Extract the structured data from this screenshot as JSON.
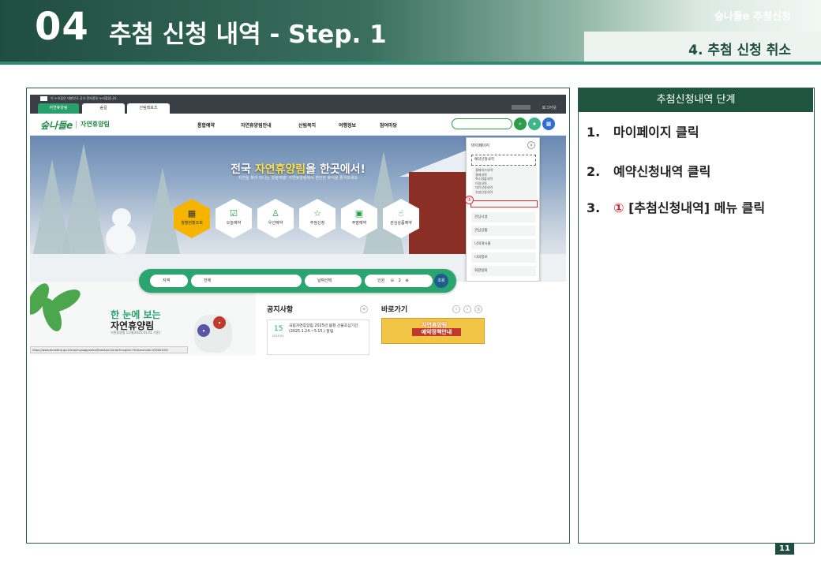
{
  "header": {
    "number": "04",
    "title": "추첨 신청 내역 - Step. 1",
    "top_right": "숲나들e 추첨신청",
    "subtitle": "4. 추첨 신청 취소"
  },
  "screenshot": {
    "gov_notice": "이 누리집은 대한민국 공식 전자정부 누리집입니다.",
    "site_tabs": [
      "자연휴양림",
      "숲길",
      "산림레포츠"
    ],
    "login": "로그아웃",
    "logo": "숲나들e",
    "logo_sub": "자연휴양림",
    "menu": [
      "통합예약",
      "자연휴양림안내",
      "산림복지",
      "여행정보",
      "참여마당"
    ],
    "hero_title_pre": "전국 ",
    "hero_title_hl": "자연휴양림",
    "hero_title_post": "을 한곳에서!",
    "hero_sub": "자연을 찾아 떠나는 힐링여행! 자연휴양림에서 편안한 휴식을 즐겨보세요",
    "quick_menu": [
      "월별현황조회",
      "오늘예약",
      "우선예약",
      "추첨신청",
      "주말예약",
      "관심상품예약"
    ],
    "dropdown": {
      "header": "마이페이지",
      "selected": "예약신청내역",
      "sub_items": [
        "결제대기내역",
        "결제내역",
        "취소환불내역",
        "이용내역",
        "대기신청내역",
        "추첨신청내역"
      ],
      "items": [
        "관심시설",
        "관심상품",
        "나의게시물",
        "나의정보",
        "회원탈퇴"
      ],
      "marker": "①"
    },
    "search_bar": {
      "region": "지역",
      "all": "전체",
      "date": "날짜선택",
      "people_label": "인원",
      "people_count": "2",
      "search": "조회"
    },
    "lower": {
      "view_title1": "한 눈에 보는",
      "view_title2": "자연휴양림",
      "view_note": "기관휴양림 11개(2025.01.01 기준)",
      "url": "https://www.foresttrip.go.kr/rep/mypage/selectDrwtAplcList.do?mngrId=F01&menuId=005001001",
      "notice_title": "공지사항",
      "notice_day": "15",
      "notice_ym": "2025.01",
      "notice_text": "국립자연휴양림 2025년 봄철 산불조심기간(2025.1.24.~5.15.) 알림",
      "shortcut_title": "바로가기",
      "banner_line1": "자연휴양림",
      "banner_line2": "예약정책안내"
    }
  },
  "panel": {
    "title": "추첨신청내역 단계",
    "steps": [
      {
        "num": "1.",
        "text": "마이페이지 클릭"
      },
      {
        "num": "2.",
        "text": "예약신청내역 클릭"
      },
      {
        "num": "3.",
        "circle": "①",
        "text": " [추첨신청내역] 메뉴 클릭"
      }
    ]
  },
  "page_number": "11"
}
